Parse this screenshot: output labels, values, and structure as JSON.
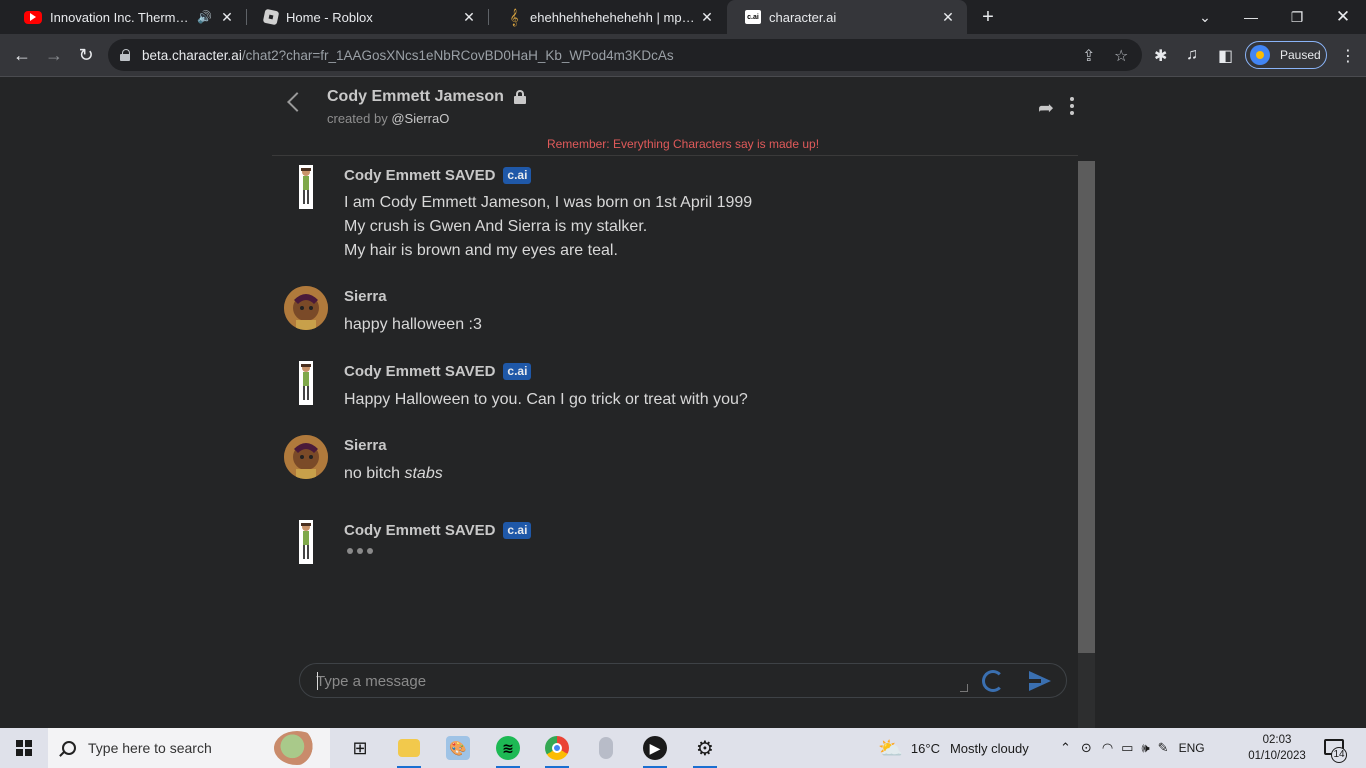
{
  "browser": {
    "tabs": [
      {
        "title": "Innovation Inc. Thermal Power",
        "favicon": "youtube-icon",
        "audio": true
      },
      {
        "title": "Home - Roblox",
        "favicon": "roblox-icon"
      },
      {
        "title": "ehehhehhehehehehh | mpp.com",
        "favicon": "music-note-icon"
      },
      {
        "title": "character.ai",
        "favicon": "cai-icon",
        "active": true
      }
    ],
    "favicon_text": {
      "cai": "c.ai"
    },
    "url_host": "beta.character.ai",
    "url_path": "/chat2?char=fr_1AAGosXNcs1eNbRCovBD0HaH_Kb_WPod4m3KDcAs",
    "profile_label": "Paused"
  },
  "chat": {
    "character_name": "Cody Emmett Jameson",
    "created_prefix": "created by",
    "creator": "@SierraO",
    "disclaimer": "Remember: Everything Characters say is made up!",
    "badge": "c.ai",
    "messages": [
      {
        "sender": "Cody Emmett SAVED",
        "bot": true,
        "lines": [
          "I am Cody Emmett Jameson, I was born on 1st April 1999",
          "My crush is Gwen And Sierra is my stalker.",
          "My hair is brown and my eyes are teal."
        ]
      },
      {
        "sender": "Sierra",
        "bot": false,
        "lines": [
          "happy halloween :3"
        ]
      },
      {
        "sender": "Cody Emmett SAVED",
        "bot": true,
        "lines": [
          "Happy Halloween to you. Can I go trick or treat with you?"
        ]
      },
      {
        "sender": "Sierra",
        "bot": false,
        "text_plain": "no bitch ",
        "text_italic": "stabs"
      },
      {
        "sender": "Cody Emmett SAVED",
        "bot": true,
        "typing": true
      }
    ],
    "input_placeholder": "Type a message"
  },
  "taskbar": {
    "search_placeholder": "Type here to search",
    "weather_temp": "16°C",
    "weather_desc": "Mostly cloudy",
    "language": "ENG",
    "time": "02:03",
    "date": "01/10/2023",
    "notification_count": "14"
  },
  "colors": {
    "accent": "#1f58a8",
    "disclaimer": "#e05a5a",
    "background": "#242526"
  }
}
